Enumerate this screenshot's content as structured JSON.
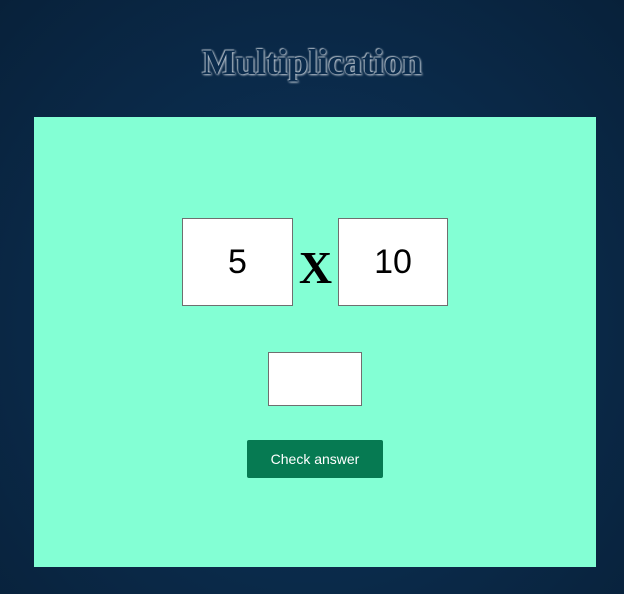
{
  "page": {
    "title": "Multiplication"
  },
  "quiz": {
    "operand_a": "5",
    "operator": "X",
    "operand_b": "10",
    "answer": {
      "value": "",
      "placeholder": ""
    },
    "check_label": "Check answer"
  },
  "colors": {
    "background": "#0b2c4d",
    "panel": "#83ffd4",
    "button": "#067a52",
    "button_text": "#ffffff"
  }
}
